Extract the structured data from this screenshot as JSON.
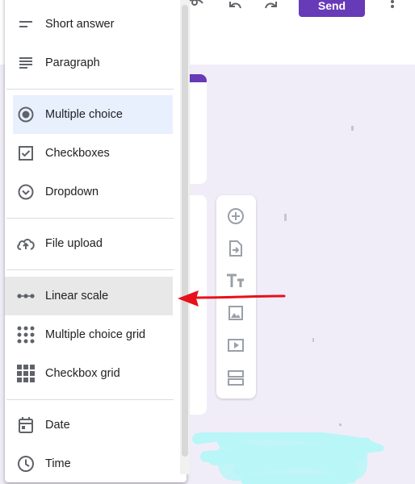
{
  "header": {
    "send_label": "Send",
    "icons": [
      "eye-icon",
      "undo-icon",
      "redo-icon",
      "more-vert-icon"
    ]
  },
  "question_type_menu": {
    "items": [
      {
        "label": "Short answer",
        "icon": "short-text-icon"
      },
      {
        "label": "Paragraph",
        "icon": "paragraph-icon"
      },
      {
        "label": "Multiple choice",
        "icon": "radio-button-icon",
        "state": "selected"
      },
      {
        "label": "Checkboxes",
        "icon": "checkbox-icon"
      },
      {
        "label": "Dropdown",
        "icon": "dropdown-circle-icon"
      },
      {
        "label": "File upload",
        "icon": "cloud-upload-icon"
      },
      {
        "label": "Linear scale",
        "icon": "linear-scale-icon",
        "state": "hover"
      },
      {
        "label": "Multiple choice grid",
        "icon": "dot-grid-icon"
      },
      {
        "label": "Checkbox grid",
        "icon": "square-grid-icon"
      },
      {
        "label": "Date",
        "icon": "calendar-icon"
      },
      {
        "label": "Time",
        "icon": "clock-icon"
      }
    ]
  },
  "floating_toolbar": {
    "icons": [
      "add-question-icon",
      "import-questions-icon",
      "add-title-icon",
      "add-image-icon",
      "add-video-icon",
      "add-section-icon"
    ]
  },
  "colors": {
    "accent": "#673ab7",
    "form_background": "#f1edf8",
    "selected_item": "#e8f0fe",
    "hover_item": "#e8e8e8",
    "annotation_arrow": "#e8101a",
    "scribble": "#b9f6f8"
  }
}
